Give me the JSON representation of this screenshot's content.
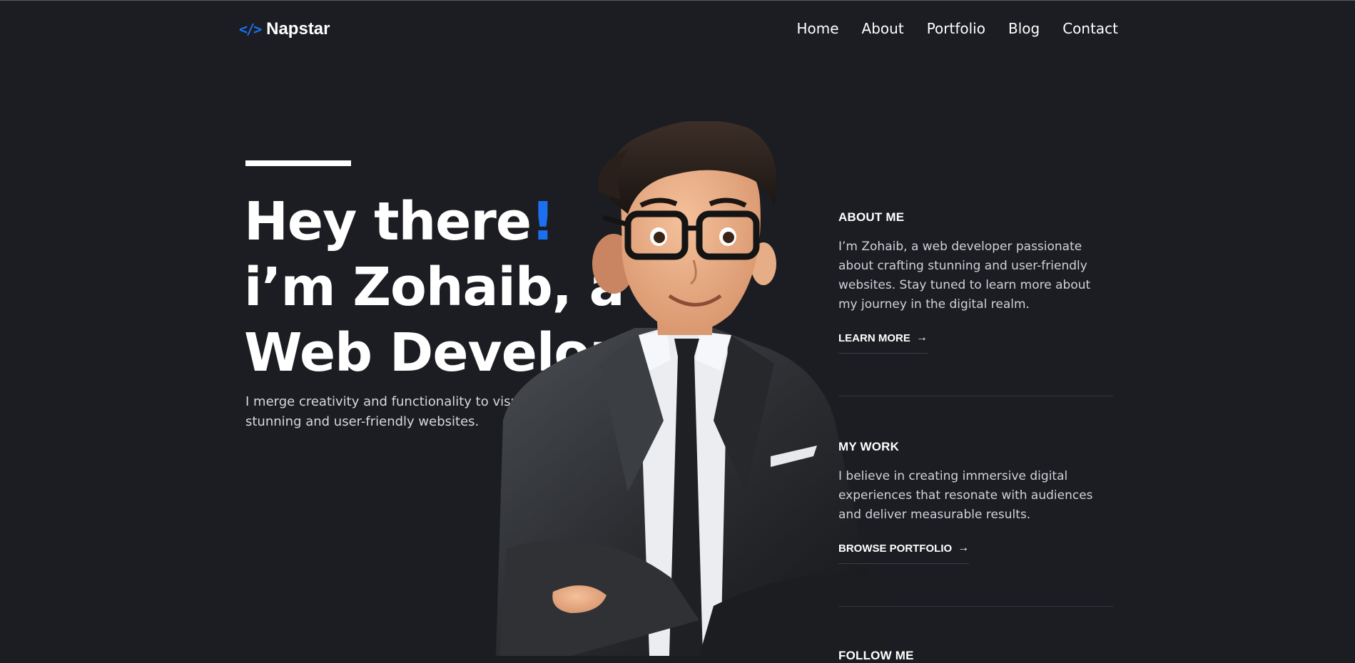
{
  "brand": {
    "name": "Napstar",
    "icon": "code-icon",
    "icon_glyph": "</>",
    "accent": "#1d6ff2"
  },
  "nav": {
    "items": [
      "Home",
      "About",
      "Portfolio",
      "Blog",
      "Contact"
    ]
  },
  "hero": {
    "line1": "Hey there",
    "exclaim": "!",
    "line2": "i’m Zohaib, a",
    "line3": "Web Developer",
    "subtitle": "I merge creativity and functionality to visually stunning and user-friendly websites."
  },
  "about": {
    "heading": "ABOUT ME",
    "text": "I’m Zohaib, a web developer passionate about crafting stunning and user-friendly websites. Stay tuned to learn more about my journey in the digital realm.",
    "cta": "LEARN MORE"
  },
  "work": {
    "heading": "MY WORK",
    "text": "I believe in creating immersive digital experiences that resonate with audiences and deliver measurable results.",
    "cta": "BROWSE PORTFOLIO"
  },
  "follow": {
    "heading": "FOLLOW ME"
  },
  "colors": {
    "background": "#1b1d22",
    "accent": "#1d6ff2",
    "text": "#ffffff"
  }
}
